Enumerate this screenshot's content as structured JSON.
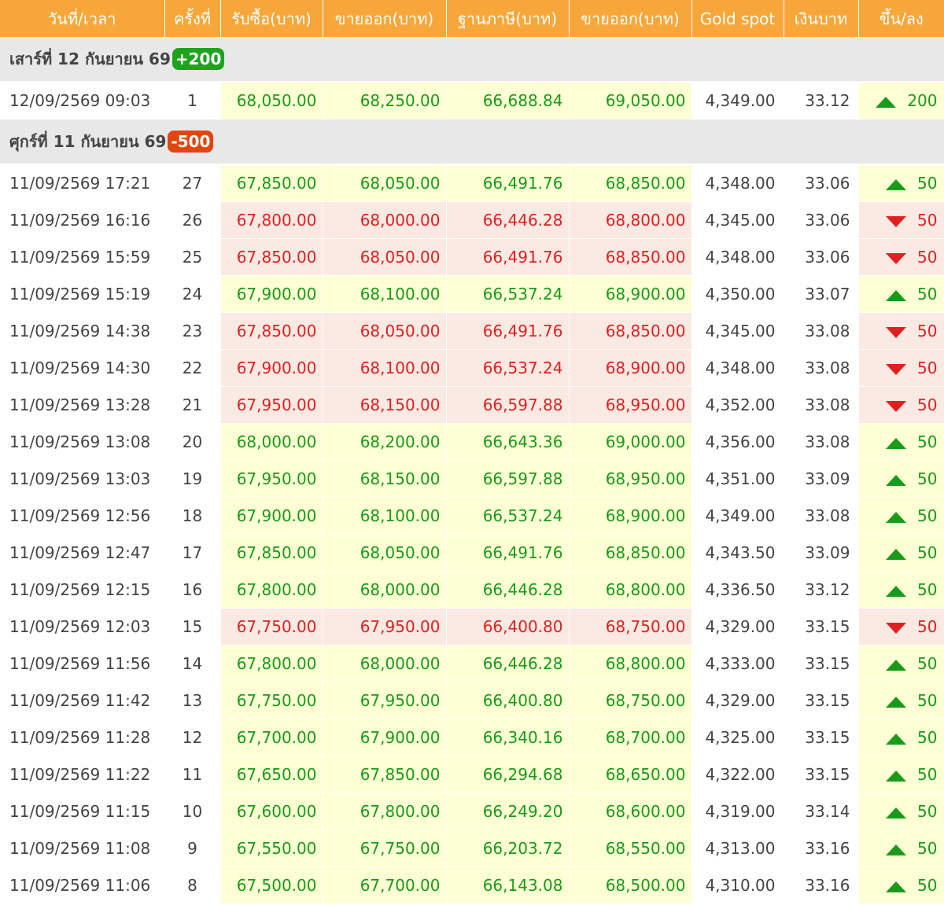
{
  "headers": [
    "วันที่/เวลา",
    "ครั้งที่",
    "รับซื้อ(บาท)",
    "ขายออก(บาท)",
    "ฐานภาษี(บาท)",
    "ขายออก(บาท)",
    "Gold spot",
    "เงินบาท",
    "ขึ้น/ลง"
  ],
  "groups": [
    {
      "label": "เสาร์ที่ 12 กันยายน 69",
      "badge": "+200",
      "direction": "up",
      "rows": [
        {
          "date": "12/09/2569 09:03",
          "round": "1",
          "buy": "68,050.00",
          "sell": "68,250.00",
          "tax_base": "66,688.84",
          "sell2": "69,050.00",
          "spot": "4,349.00",
          "baht": "33.12",
          "change": "200",
          "direction": "up"
        }
      ]
    },
    {
      "label": "ศุกร์ที่ 11 กันยายน 69",
      "badge": "-500",
      "direction": "down",
      "rows": [
        {
          "date": "11/09/2569 17:21",
          "round": "27",
          "buy": "67,850.00",
          "sell": "68,050.00",
          "tax_base": "66,491.76",
          "sell2": "68,850.00",
          "spot": "4,348.00",
          "baht": "33.06",
          "change": "50",
          "direction": "up"
        },
        {
          "date": "11/09/2569 16:16",
          "round": "26",
          "buy": "67,800.00",
          "sell": "68,000.00",
          "tax_base": "66,446.28",
          "sell2": "68,800.00",
          "spot": "4,345.00",
          "baht": "33.06",
          "change": "50",
          "direction": "down"
        },
        {
          "date": "11/09/2569 15:59",
          "round": "25",
          "buy": "67,850.00",
          "sell": "68,050.00",
          "tax_base": "66,491.76",
          "sell2": "68,850.00",
          "spot": "4,348.00",
          "baht": "33.06",
          "change": "50",
          "direction": "down"
        },
        {
          "date": "11/09/2569 15:19",
          "round": "24",
          "buy": "67,900.00",
          "sell": "68,100.00",
          "tax_base": "66,537.24",
          "sell2": "68,900.00",
          "spot": "4,350.00",
          "baht": "33.07",
          "change": "50",
          "direction": "up"
        },
        {
          "date": "11/09/2569 14:38",
          "round": "23",
          "buy": "67,850.00",
          "sell": "68,050.00",
          "tax_base": "66,491.76",
          "sell2": "68,850.00",
          "spot": "4,345.00",
          "baht": "33.08",
          "change": "50",
          "direction": "down"
        },
        {
          "date": "11/09/2569 14:30",
          "round": "22",
          "buy": "67,900.00",
          "sell": "68,100.00",
          "tax_base": "66,537.24",
          "sell2": "68,900.00",
          "spot": "4,348.00",
          "baht": "33.08",
          "change": "50",
          "direction": "down"
        },
        {
          "date": "11/09/2569 13:28",
          "round": "21",
          "buy": "67,950.00",
          "sell": "68,150.00",
          "tax_base": "66,597.88",
          "sell2": "68,950.00",
          "spot": "4,352.00",
          "baht": "33.08",
          "change": "50",
          "direction": "down"
        },
        {
          "date": "11/09/2569 13:08",
          "round": "20",
          "buy": "68,000.00",
          "sell": "68,200.00",
          "tax_base": "66,643.36",
          "sell2": "69,000.00",
          "spot": "4,356.00",
          "baht": "33.08",
          "change": "50",
          "direction": "up"
        },
        {
          "date": "11/09/2569 13:03",
          "round": "19",
          "buy": "67,950.00",
          "sell": "68,150.00",
          "tax_base": "66,597.88",
          "sell2": "68,950.00",
          "spot": "4,351.00",
          "baht": "33.09",
          "change": "50",
          "direction": "up"
        },
        {
          "date": "11/09/2569 12:56",
          "round": "18",
          "buy": "67,900.00",
          "sell": "68,100.00",
          "tax_base": "66,537.24",
          "sell2": "68,900.00",
          "spot": "4,349.00",
          "baht": "33.08",
          "change": "50",
          "direction": "up"
        },
        {
          "date": "11/09/2569 12:47",
          "round": "17",
          "buy": "67,850.00",
          "sell": "68,050.00",
          "tax_base": "66,491.76",
          "sell2": "68,850.00",
          "spot": "4,343.50",
          "baht": "33.09",
          "change": "50",
          "direction": "up"
        },
        {
          "date": "11/09/2569 12:15",
          "round": "16",
          "buy": "67,800.00",
          "sell": "68,000.00",
          "tax_base": "66,446.28",
          "sell2": "68,800.00",
          "spot": "4,336.50",
          "baht": "33.12",
          "change": "50",
          "direction": "up"
        },
        {
          "date": "11/09/2569 12:03",
          "round": "15",
          "buy": "67,750.00",
          "sell": "67,950.00",
          "tax_base": "66,400.80",
          "sell2": "68,750.00",
          "spot": "4,329.00",
          "baht": "33.15",
          "change": "50",
          "direction": "down"
        },
        {
          "date": "11/09/2569 11:56",
          "round": "14",
          "buy": "67,800.00",
          "sell": "68,000.00",
          "tax_base": "66,446.28",
          "sell2": "68,800.00",
          "spot": "4,333.00",
          "baht": "33.15",
          "change": "50",
          "direction": "up"
        },
        {
          "date": "11/09/2569 11:42",
          "round": "13",
          "buy": "67,750.00",
          "sell": "67,950.00",
          "tax_base": "66,400.80",
          "sell2": "68,750.00",
          "spot": "4,329.00",
          "baht": "33.15",
          "change": "50",
          "direction": "up"
        },
        {
          "date": "11/09/2569 11:28",
          "round": "12",
          "buy": "67,700.00",
          "sell": "67,900.00",
          "tax_base": "66,340.16",
          "sell2": "68,700.00",
          "spot": "4,325.00",
          "baht": "33.15",
          "change": "50",
          "direction": "up"
        },
        {
          "date": "11/09/2569 11:22",
          "round": "11",
          "buy": "67,650.00",
          "sell": "67,850.00",
          "tax_base": "66,294.68",
          "sell2": "68,650.00",
          "spot": "4,322.00",
          "baht": "33.15",
          "change": "50",
          "direction": "up"
        },
        {
          "date": "11/09/2569 11:15",
          "round": "10",
          "buy": "67,600.00",
          "sell": "67,800.00",
          "tax_base": "66,249.20",
          "sell2": "68,600.00",
          "spot": "4,319.00",
          "baht": "33.14",
          "change": "50",
          "direction": "up"
        },
        {
          "date": "11/09/2569 11:08",
          "round": "9",
          "buy": "67,550.00",
          "sell": "67,750.00",
          "tax_base": "66,203.72",
          "sell2": "68,550.00",
          "spot": "4,313.00",
          "baht": "33.16",
          "change": "50",
          "direction": "up"
        },
        {
          "date": "11/09/2569 11:06",
          "round": "8",
          "buy": "67,500.00",
          "sell": "67,700.00",
          "tax_base": "66,143.08",
          "sell2": "68,500.00",
          "spot": "4,310.00",
          "baht": "33.16",
          "change": "50",
          "direction": "up"
        }
      ]
    }
  ]
}
